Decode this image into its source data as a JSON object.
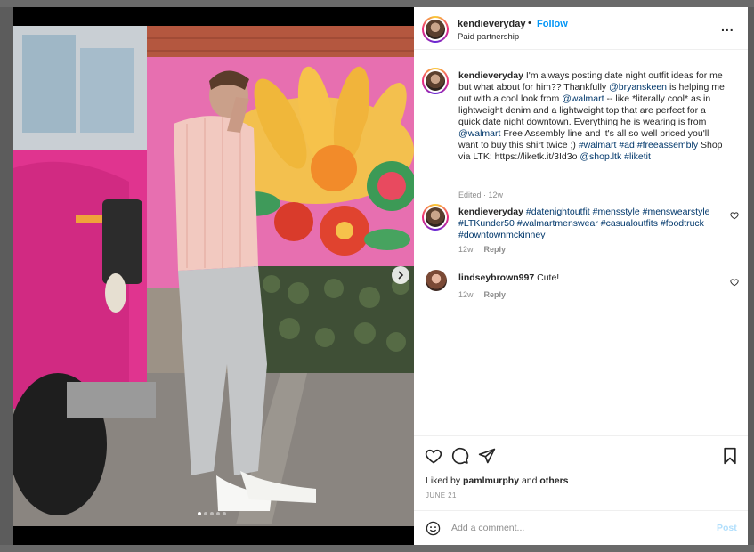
{
  "post": {
    "username": "kendieveryday",
    "separator": "•",
    "follow_label": "Follow",
    "subtitle": "Paid partnership",
    "more_label": "...",
    "carousel": {
      "total_slides": 5,
      "active_slide": 1
    }
  },
  "caption": {
    "username": "kendieveryday",
    "text_1": "I'm always posting date night outfit ideas for me but what about for him?? Thankfully ",
    "mention_1": "@bryanskeen",
    "text_2": " is helping me out with a cool look from ",
    "mention_2": "@walmart",
    "text_3": " -- like *literally cool* as in lightweight denim and a lightweight top that are perfect for a quick date night downtown. Everything he is wearing is from ",
    "mention_3": "@walmart",
    "text_4": " Free Assembly line and it's all so well priced you'll want to buy this shirt twice ;) ",
    "tag_1": "#walmart",
    "tag_2": "#ad",
    "tag_3": "#freeassembly",
    "text_5": " Shop via LTK: https://liketk.it/3Id3o ",
    "mention_4": "@shop.ltk",
    "tag_4": "#liketit",
    "meta": "Edited · 12w"
  },
  "comments": [
    {
      "username": "kendieveryday",
      "tags": [
        "#datenightoutfit",
        "#mensstyle",
        "#menswearstyle",
        "#LTKunder50",
        "#walmartmenswear",
        "#casualoutfits",
        "#foodtruck",
        "#downtownmckinney"
      ],
      "age": "12w",
      "reply_label": "Reply"
    },
    {
      "username": "lindseybrown997",
      "text": "Cute!",
      "age": "12w",
      "reply_label": "Reply"
    }
  ],
  "engagement": {
    "liked_prefix": "Liked by",
    "liked_user": "pamlmurphy",
    "liked_and": "and",
    "liked_others": "others",
    "date": "JUNE 21"
  },
  "composer": {
    "placeholder": "Add a comment...",
    "post_label": "Post"
  },
  "icons": {
    "like": "heart-icon",
    "comment": "comment-icon",
    "share": "paper-plane-icon",
    "save": "bookmark-icon",
    "emoji": "smiley-icon",
    "next": "chevron-right-icon"
  },
  "colors": {
    "accent": "#0095f6",
    "link": "#00376b",
    "post_disabled": "#b2dffc"
  }
}
